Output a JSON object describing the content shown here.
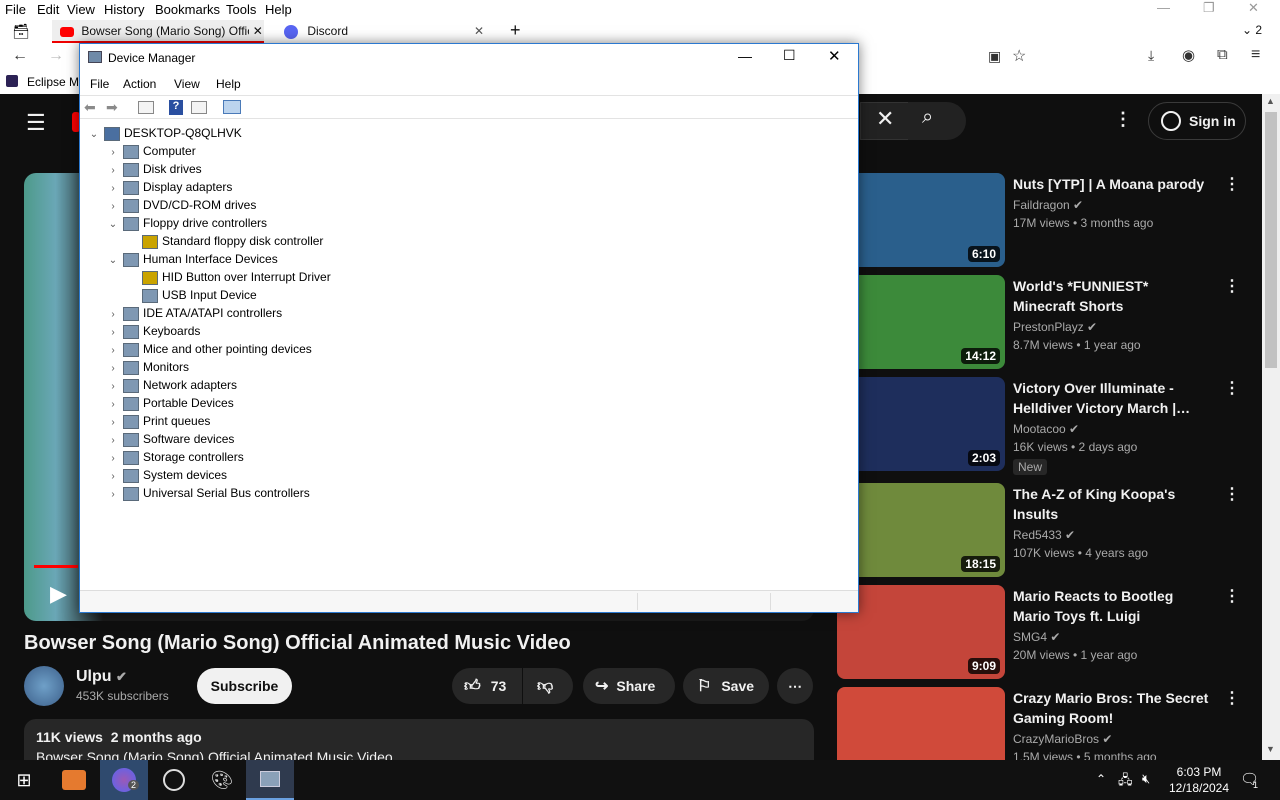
{
  "firefox": {
    "menu": [
      "File",
      "Edit",
      "View",
      "History",
      "Bookmarks",
      "Tools",
      "Help"
    ],
    "tabs": [
      {
        "title": "Bowser Song (Mario Song) Offic",
        "active": true
      },
      {
        "title": "Discord",
        "active": false
      }
    ],
    "tab_count": "2",
    "bookmark": "Eclipse M"
  },
  "youtube": {
    "sign_in": "Sign in",
    "video": {
      "title": "Bowser Song (Mario Song) Official Animated Music Video",
      "channel": "Ulpu",
      "subscribers": "453K subscribers",
      "subscribe": "Subscribe",
      "likes": "73",
      "share": "Share",
      "save": "Save",
      "views": "11K views",
      "age": "2 months ago",
      "desc": "Bowser Song (Mario Song) Official Animated Music Video"
    },
    "recommended": [
      {
        "title": "Nuts [YTP] | A Moana parody",
        "channel": "Faildragon",
        "meta": "17M views • 3 months ago",
        "duration": "6:10",
        "thumb_color": "#2a5f8c",
        "badge": ""
      },
      {
        "title": "World's *FUNNIEST* Minecraft Shorts",
        "channel": "PrestonPlayz",
        "meta": "8.7M views • 1 year ago",
        "duration": "14:12",
        "thumb_color": "#3c8a3a",
        "badge": ""
      },
      {
        "title": "Victory Over Illuminate - Helldiver Victory March |…",
        "channel": "Mootacoo",
        "meta": "16K views • 2 days ago",
        "duration": "2:03",
        "thumb_color": "#1e2e5c",
        "badge": "New"
      },
      {
        "title": "The A-Z of King Koopa's Insults",
        "channel": "Red5433",
        "meta": "107K views • 4 years ago",
        "duration": "18:15",
        "thumb_color": "#6f8a3c",
        "badge": ""
      },
      {
        "title": "Mario Reacts to Bootleg Mario Toys ft. Luigi",
        "channel": "SMG4",
        "meta": "20M views • 1 year ago",
        "duration": "9:09",
        "thumb_color": "#c4453a",
        "badge": ""
      },
      {
        "title": "Crazy Mario Bros: The Secret Gaming Room!",
        "channel": "CrazyMarioBros",
        "meta": "1.5M views • 5 months ago",
        "duration": "",
        "thumb_color": "#d04a3a",
        "badge": ""
      }
    ]
  },
  "device_manager": {
    "title": "Device Manager",
    "menu": [
      "File",
      "Action",
      "View",
      "Help"
    ],
    "tree": [
      {
        "label": "DESKTOP-Q8QLHVK",
        "level": 0,
        "expanded": true,
        "icon": "computer-root-icon"
      },
      {
        "label": "Computer",
        "level": 1,
        "expanded": false,
        "icon": "monitor-icon"
      },
      {
        "label": "Disk drives",
        "level": 1,
        "expanded": false,
        "icon": "disk-drive-icon"
      },
      {
        "label": "Display adapters",
        "level": 1,
        "expanded": false,
        "icon": "display-adapter-icon"
      },
      {
        "label": "DVD/CD-ROM drives",
        "level": 1,
        "expanded": false,
        "icon": "dvd-icon"
      },
      {
        "label": "Floppy drive controllers",
        "level": 1,
        "expanded": true,
        "icon": "floppy-controller-icon"
      },
      {
        "label": "Standard floppy disk controller",
        "level": 2,
        "expanded": null,
        "icon": "warning-device-icon"
      },
      {
        "label": "Human Interface Devices",
        "level": 1,
        "expanded": true,
        "icon": "hid-icon"
      },
      {
        "label": "HID Button over Interrupt Driver",
        "level": 2,
        "expanded": null,
        "icon": "warning-device-icon"
      },
      {
        "label": "USB Input Device",
        "level": 2,
        "expanded": null,
        "icon": "hid-device-icon"
      },
      {
        "label": "IDE ATA/ATAPI controllers",
        "level": 1,
        "expanded": false,
        "icon": "ide-icon"
      },
      {
        "label": "Keyboards",
        "level": 1,
        "expanded": false,
        "icon": "keyboard-icon"
      },
      {
        "label": "Mice and other pointing devices",
        "level": 1,
        "expanded": false,
        "icon": "mouse-icon"
      },
      {
        "label": "Monitors",
        "level": 1,
        "expanded": false,
        "icon": "monitor-icon"
      },
      {
        "label": "Network adapters",
        "level": 1,
        "expanded": false,
        "icon": "network-icon"
      },
      {
        "label": "Portable Devices",
        "level": 1,
        "expanded": false,
        "icon": "portable-device-icon"
      },
      {
        "label": "Print queues",
        "level": 1,
        "expanded": false,
        "icon": "printer-icon"
      },
      {
        "label": "Software devices",
        "level": 1,
        "expanded": false,
        "icon": "software-device-icon"
      },
      {
        "label": "Storage controllers",
        "level": 1,
        "expanded": false,
        "icon": "storage-icon"
      },
      {
        "label": "System devices",
        "level": 1,
        "expanded": false,
        "icon": "system-device-icon"
      },
      {
        "label": "Universal Serial Bus controllers",
        "level": 1,
        "expanded": false,
        "icon": "usb-icon"
      }
    ]
  },
  "taskbar": {
    "time": "6:03 PM",
    "date": "12/18/2024",
    "notification_count": "1",
    "firefox_badge": "2"
  },
  "colors": {
    "yt_bg": "#0f0f0f",
    "dm_accent": "#2b79d0",
    "taskbar_active": "#2f4a6e"
  }
}
